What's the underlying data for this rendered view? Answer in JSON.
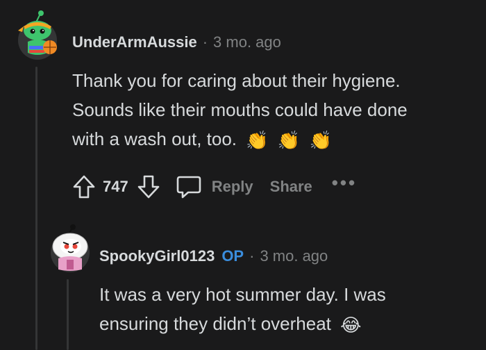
{
  "comments": [
    {
      "username": "UnderArmAussie",
      "separator": "·",
      "time": "3 mo. ago",
      "lines": [
        "Thank you for caring about their hygiene.",
        "Sounds like their mouths could have done",
        "with a wash out, too."
      ],
      "emoji": [
        "👏",
        "👏",
        "👏"
      ],
      "score": "747",
      "reply_label": "Reply",
      "share_label": "Share",
      "more_label": "•••"
    },
    {
      "username": "SpookyGirl0123",
      "badge": "OP",
      "separator": "·",
      "time": "3 mo. ago",
      "lines": [
        "It was a very hot summer day. I was",
        "ensuring they didn’t overheat"
      ],
      "emoji": [
        "😂"
      ]
    }
  ],
  "colors": {
    "background": "#1a1a1b",
    "text": "#d7dadc",
    "meta": "#818384",
    "op_badge": "#3a8ddd",
    "avatar1": "#3ec46d",
    "avatar2_hood": "#f4f4f4"
  }
}
